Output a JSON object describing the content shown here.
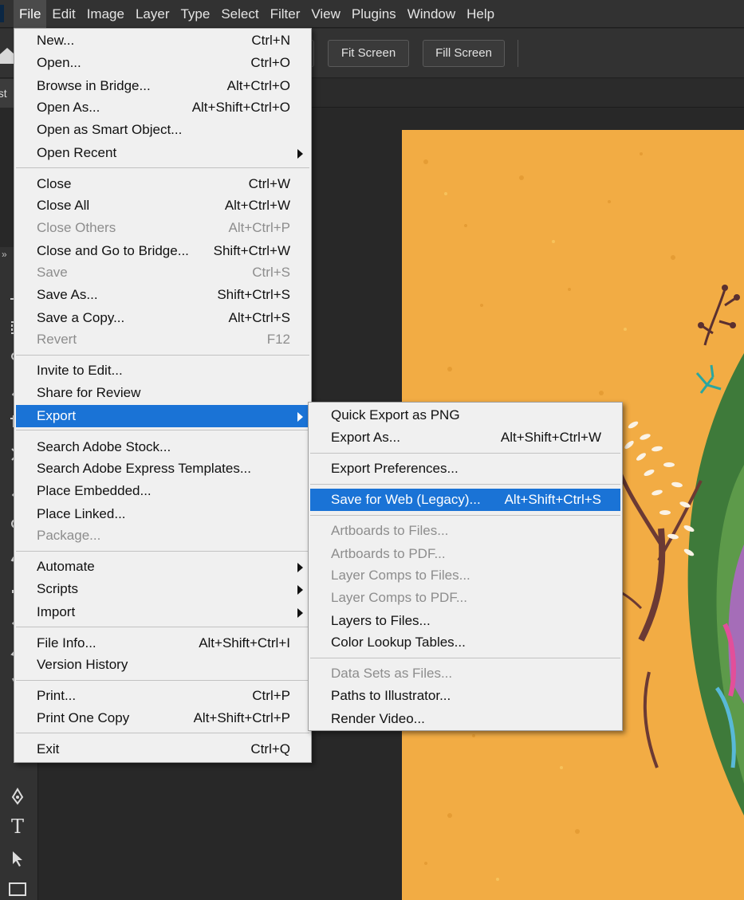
{
  "menubar": {
    "items": [
      "File",
      "Edit",
      "Image",
      "Layer",
      "Type",
      "Select",
      "Filter",
      "View",
      "Plugins",
      "Window",
      "Help"
    ]
  },
  "optionsbar": {
    "fit_screen": "Fit Screen",
    "fill_screen": "Fill Screen"
  },
  "tabbar": {
    "doc_tab": "ost"
  },
  "file_menu": {
    "items": [
      {
        "label": "New...",
        "shortcut": "Ctrl+N"
      },
      {
        "label": "Open...",
        "shortcut": "Ctrl+O"
      },
      {
        "label": "Browse in Bridge...",
        "shortcut": "Alt+Ctrl+O"
      },
      {
        "label": "Open As...",
        "shortcut": "Alt+Shift+Ctrl+O"
      },
      {
        "label": "Open as Smart Object...",
        "shortcut": ""
      },
      {
        "label": "Open Recent",
        "shortcut": ""
      },
      {
        "label": "Close",
        "shortcut": "Ctrl+W"
      },
      {
        "label": "Close All",
        "shortcut": "Alt+Ctrl+W"
      },
      {
        "label": "Close Others",
        "shortcut": "Alt+Ctrl+P"
      },
      {
        "label": "Close and Go to Bridge...",
        "shortcut": "Shift+Ctrl+W"
      },
      {
        "label": "Save",
        "shortcut": "Ctrl+S"
      },
      {
        "label": "Save As...",
        "shortcut": "Shift+Ctrl+S"
      },
      {
        "label": "Save a Copy...",
        "shortcut": "Alt+Ctrl+S"
      },
      {
        "label": "Revert",
        "shortcut": "F12"
      },
      {
        "label": "Invite to Edit...",
        "shortcut": ""
      },
      {
        "label": "Share for Review",
        "shortcut": ""
      },
      {
        "label": "Export",
        "shortcut": ""
      },
      {
        "label": "Search Adobe Stock...",
        "shortcut": ""
      },
      {
        "label": "Search Adobe Express Templates...",
        "shortcut": ""
      },
      {
        "label": "Place Embedded...",
        "shortcut": ""
      },
      {
        "label": "Place Linked...",
        "shortcut": ""
      },
      {
        "label": "Package...",
        "shortcut": ""
      },
      {
        "label": "Automate",
        "shortcut": ""
      },
      {
        "label": "Scripts",
        "shortcut": ""
      },
      {
        "label": "Import",
        "shortcut": ""
      },
      {
        "label": "File Info...",
        "shortcut": "Alt+Shift+Ctrl+I"
      },
      {
        "label": "Version History",
        "shortcut": ""
      },
      {
        "label": "Print...",
        "shortcut": "Ctrl+P"
      },
      {
        "label": "Print One Copy",
        "shortcut": "Alt+Shift+Ctrl+P"
      },
      {
        "label": "Exit",
        "shortcut": "Ctrl+Q"
      }
    ]
  },
  "export_menu": {
    "items": [
      {
        "label": "Quick Export as PNG",
        "shortcut": ""
      },
      {
        "label": "Export As...",
        "shortcut": "Alt+Shift+Ctrl+W"
      },
      {
        "label": "Export Preferences...",
        "shortcut": ""
      },
      {
        "label": "Save for Web (Legacy)...",
        "shortcut": "Alt+Shift+Ctrl+S"
      },
      {
        "label": "Artboards to Files...",
        "shortcut": ""
      },
      {
        "label": "Artboards to PDF...",
        "shortcut": ""
      },
      {
        "label": "Layer Comps to Files...",
        "shortcut": ""
      },
      {
        "label": "Layer Comps to PDF...",
        "shortcut": ""
      },
      {
        "label": "Layers to Files...",
        "shortcut": ""
      },
      {
        "label": "Color Lookup Tables...",
        "shortcut": ""
      },
      {
        "label": "Data Sets as Files...",
        "shortcut": ""
      },
      {
        "label": "Paths to Illustrator...",
        "shortcut": ""
      },
      {
        "label": "Render Video...",
        "shortcut": ""
      }
    ]
  },
  "tools": {
    "collapse": "»",
    "type_tool": "T"
  },
  "colors": {
    "menu_highlight": "#1a73d6",
    "canvas_background": "#f2ac44",
    "app_background": "#282828"
  }
}
